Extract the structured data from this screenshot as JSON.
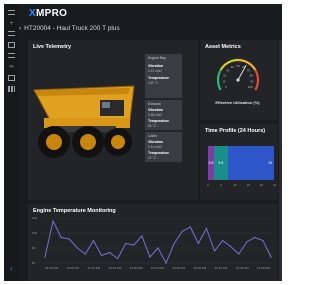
{
  "app": {
    "logo": {
      "mark": "X",
      "rest": "MPRO"
    },
    "breadcrumb": "HT20004 - Haul Truck 200 T plus",
    "accent_color": "#1f8fff"
  },
  "rail": [
    "menu-icon",
    "plus-icon",
    "list-icon",
    "document-icon",
    "layers-icon",
    "link-icon",
    "table-icon",
    "grid-icon",
    "chevron-icon"
  ],
  "live_telemetry": {
    "title": "Live Telemetry",
    "tiles": [
      {
        "title": "Engine Bay",
        "m1": "Vibration",
        "v1": "0.21 m/s2",
        "m2": "Temperature",
        "v2": "102 °C"
      },
      {
        "title": "Exhaust",
        "m1": "Vibration",
        "v1": "0.35 m/s2",
        "m2": "Temperature",
        "v2": "84 °C"
      },
      {
        "title": "Cabin",
        "m1": "Vibration",
        "v1": "0.14 m/s2",
        "m2": "Temperature",
        "v2": "22 °C"
      }
    ]
  },
  "asset_metrics": {
    "title": "Asset Metrics",
    "gauge_caption": "Effective Utilization (%)",
    "gauge_value": 62,
    "gauge_labels": [
      "0",
      "10",
      "20",
      "30",
      "40",
      "50",
      "60",
      "70",
      "80",
      "90",
      "100"
    ]
  },
  "time_profile": {
    "title": "Time Profile (24 Hours)",
    "segments": [
      {
        "label": "3.5",
        "fraction": 0.09,
        "color": "#7a3fa3"
      },
      {
        "label": "5.5",
        "fraction": 0.21,
        "color": "#1a8e8a"
      },
      {
        "label": "15",
        "fraction": 0.7,
        "color": "#2f56c9"
      }
    ],
    "ticks": [
      "0",
      "5",
      "10",
      "15",
      "20",
      "24"
    ]
  },
  "engine_temp": {
    "title": "Engine Temperature Monitoring",
    "line_color": "#7b6fd6",
    "y_ticks": [
      "110",
      "100",
      "90",
      "80"
    ],
    "x_ticks": [
      "12:00 PM",
      "12:05 PM",
      "12:10 PM",
      "12:15 PM",
      "12:20 PM",
      "12:25 PM",
      "12:30 PM",
      "12:35 PM",
      "12:40 PM",
      "12:45 PM",
      "12:50 PM"
    ],
    "values": [
      84,
      108,
      97,
      96,
      90,
      86,
      95,
      85,
      87,
      83,
      93,
      92,
      98,
      84,
      90,
      80,
      93,
      101,
      104,
      93,
      103,
      88,
      95,
      91,
      86,
      94,
      97,
      95,
      84
    ]
  }
}
